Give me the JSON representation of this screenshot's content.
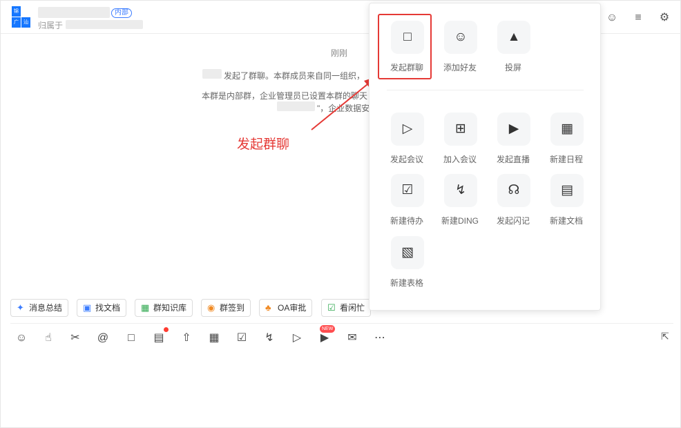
{
  "header": {
    "tag_internal": "内部",
    "subtitle_prefix": "归属于",
    "logo_chars": [
      "锦",
      "",
      "广",
      "汕"
    ]
  },
  "messages": {
    "time": "刚刚",
    "line1": "发起了群聊。本群成员来自同一组织，",
    "line2": "本群是内部群，企业管理员已设置本群的聊天",
    "line3": "\"，企业数据安"
  },
  "annotation": "发起群聊",
  "quick_tools": [
    {
      "label": "消息总结",
      "icon": "sparkle-icon",
      "color": "#3b7cff"
    },
    {
      "label": "找文档",
      "icon": "doc-search-icon",
      "color": "#3b7cff"
    },
    {
      "label": "群知识库",
      "icon": "knowledge-base-icon",
      "color": "#2fa84f"
    },
    {
      "label": "群签到",
      "icon": "location-pin-icon",
      "color": "#f08a24"
    },
    {
      "label": "OA审批",
      "icon": "stamp-icon",
      "color": "#f08a24"
    },
    {
      "label": "看闲忙",
      "icon": "calendar-check-icon",
      "color": "#2fa84f"
    }
  ],
  "popup": {
    "top_items": [
      {
        "label": "发起群聊",
        "icon": "chat-bubble-icon"
      },
      {
        "label": "添加好友",
        "icon": "add-friend-icon"
      },
      {
        "label": "投屏",
        "icon": "screen-cast-icon"
      }
    ],
    "grid_items": [
      {
        "label": "发起会议",
        "icon": "video-camera-icon"
      },
      {
        "label": "加入会议",
        "icon": "plus-square-icon"
      },
      {
        "label": "发起直播",
        "icon": "live-tv-icon"
      },
      {
        "label": "新建日程",
        "icon": "calendar-icon"
      },
      {
        "label": "新建待办",
        "icon": "checkbox-icon"
      },
      {
        "label": "新建DING",
        "icon": "lightning-icon"
      },
      {
        "label": "发起闪记",
        "icon": "mic-note-icon"
      },
      {
        "label": "新建文档",
        "icon": "document-icon"
      },
      {
        "label": "新建表格",
        "icon": "table-sheet-icon"
      }
    ]
  },
  "toolbar": {
    "new_badge": "NEW",
    "icons": [
      "emoji-icon",
      "thumbs-up-icon",
      "scissors-icon",
      "at-icon",
      "slash-command-icon",
      "note-add-icon",
      "upload-icon",
      "calendar-icon",
      "checkbox-icon",
      "lightning-icon",
      "video-icon",
      "play-icon",
      "mail-icon",
      "more-icon"
    ]
  },
  "colors": {
    "accent": "#1677ff",
    "annotation_red": "#e53935"
  }
}
